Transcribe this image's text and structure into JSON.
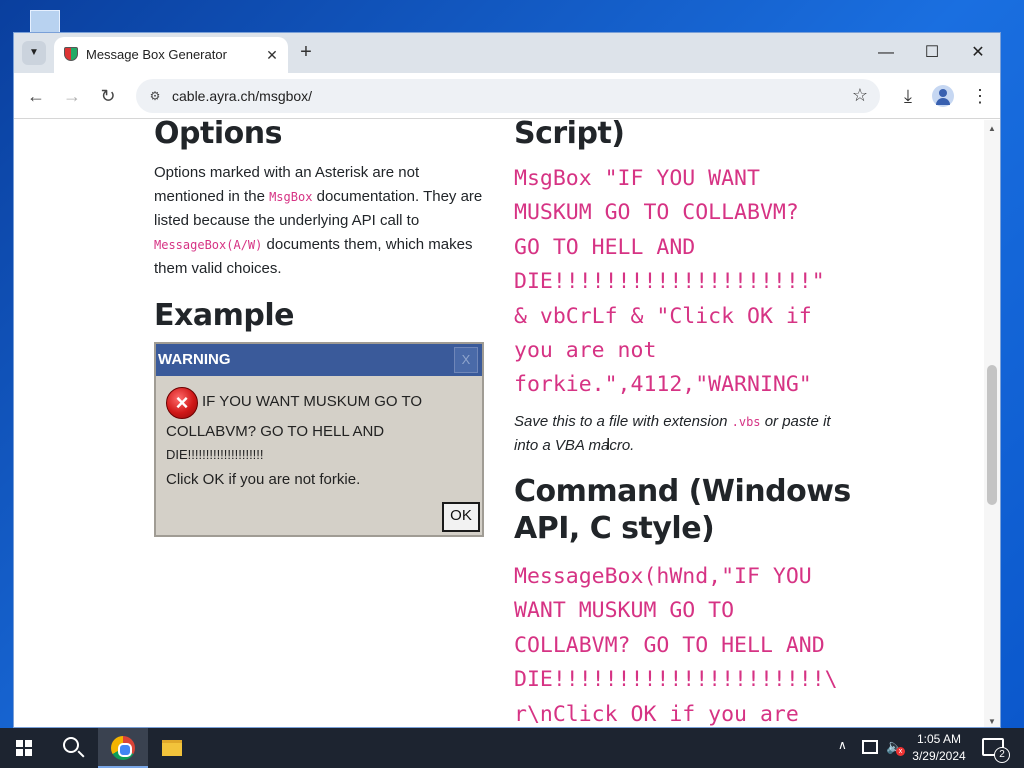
{
  "browser": {
    "tab_title": "Message Box Generator",
    "url": "cable.ayra.ch/msgbox/",
    "window_controls": {
      "minimize": "—",
      "maximize": "☐",
      "close": "✕"
    }
  },
  "page": {
    "options": {
      "heading": "Options",
      "text_1": "Options marked with an Asterisk are not mentioned in the ",
      "code_1": "MsgBox",
      "text_2": " documentation. They are listed because the underlying API call to ",
      "code_2": "MessageBox(A/W)",
      "text_3": " documents them, which makes them valid choices."
    },
    "example": {
      "heading": "Example",
      "msgbox": {
        "title": "WARNING",
        "close": "X",
        "lines": [
          "IF YOU WANT MUSKUM GO TO",
          "COLLABVM? GO TO HELL AND",
          "DIE!!!!!!!!!!!!!!!!!!!!!",
          "Click OK if you are not forkie."
        ],
        "ok_label": "OK"
      }
    },
    "script": {
      "heading": "Script)",
      "code_lines": [
        "MsgBox \"IF YOU WANT",
        "MUSKUM GO TO COLLABVM?",
        "GO TO HELL AND",
        "DIE!!!!!!!!!!!!!!!!!!!!\"",
        "& vbCrLf & \"Click OK if",
        "you are not",
        "forkie.\",4112,\"WARNING\""
      ],
      "note_1": "Save this to a file with extension ",
      "note_code": ".vbs",
      "note_2": " or paste it into a VBA macro."
    },
    "command": {
      "heading_line1": "Command (Windows",
      "heading_line2": "API, C style)",
      "code_lines": [
        "MessageBox(hWnd,\"IF YOU",
        "WANT MUSKUM GO TO",
        "COLLABVM? GO TO HELL AND",
        "DIE!!!!!!!!!!!!!!!!!!!!!\\",
        "r\\nClick OK if you are"
      ]
    }
  },
  "taskbar": {
    "time": "1:05 AM",
    "date": "3/29/2024",
    "notification_count": "2"
  }
}
